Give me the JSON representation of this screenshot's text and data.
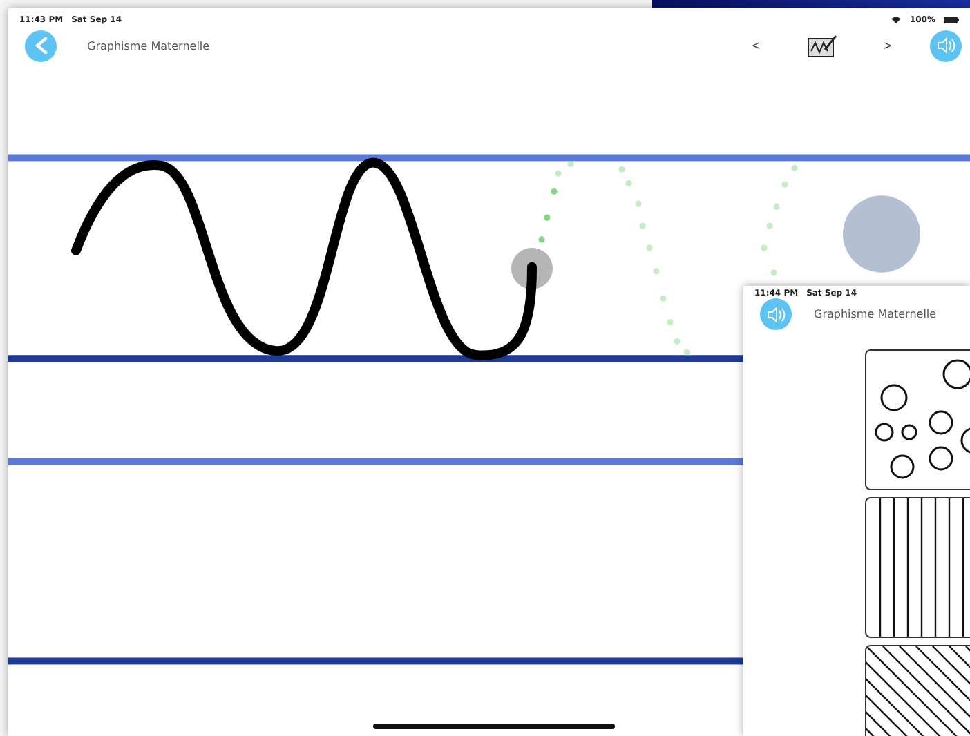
{
  "main_window": {
    "status_bar": {
      "time": "11:43 PM",
      "date": "Sat Sep 14",
      "battery": "100%"
    },
    "nav": {
      "title": "Graphisme Maternelle",
      "prev": "<",
      "next": ">"
    }
  },
  "second_window": {
    "status_bar": {
      "time": "11:44 PM",
      "date": "Sat Sep 14"
    },
    "title": "Graphisme Maternelle"
  }
}
